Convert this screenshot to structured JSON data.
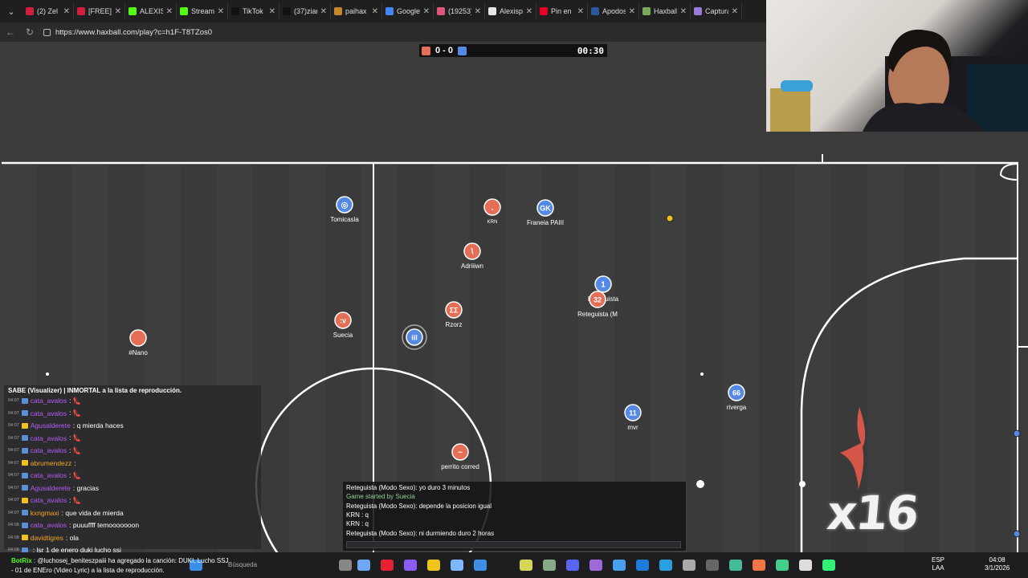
{
  "browser": {
    "tabs": [
      {
        "title": "(2) Zel",
        "color": "#d01f3c"
      },
      {
        "title": "[FREE] E",
        "color": "#d01f3c"
      },
      {
        "title": "ALEXIS",
        "color": "#53fc18"
      },
      {
        "title": "Stream",
        "color": "#53fc18"
      },
      {
        "title": "TikTok",
        "color": "#111111"
      },
      {
        "title": "(37)zian",
        "color": "#111111"
      },
      {
        "title": "paihax",
        "color": "#c8862b"
      },
      {
        "title": "Google",
        "color": "#4285f4"
      },
      {
        "title": "(19253)",
        "color": "#e0567a"
      },
      {
        "title": "Alexisp",
        "color": "#e6e6e6"
      },
      {
        "title": "Pin en",
        "color": "#e60023"
      },
      {
        "title": "Apodos",
        "color": "#2b579a"
      },
      {
        "title": "Haxball",
        "color": "#7aa75a"
      },
      {
        "title": "Captura",
        "color": "#9b7bd8"
      }
    ],
    "url": "https://www.haxball.com/play?c=h1F-T8TZos0"
  },
  "scoreboard": {
    "score": "0 - 0",
    "time": "00:30",
    "red_color": "#e56e56",
    "blue_color": "#5689e5"
  },
  "players": [
    {
      "label": "◎",
      "name": "Tomicasla",
      "team": "blue"
    },
    {
      "label": ".",
      "name": "KRN",
      "team": "red"
    },
    {
      "label": "GK",
      "name": "Franeia PAIII",
      "team": "blue"
    },
    {
      "label": "\\",
      "name": "Adriiiwn",
      "team": "red"
    },
    {
      "label": "1",
      "name": "Retequista",
      "team": "blue"
    },
    {
      "label": "32",
      "name": "Reteguista (M",
      "team": "red"
    },
    {
      "label": ":v",
      "name": "Suecia",
      "team": "red"
    },
    {
      "label": "ΣΣ",
      "name": "Rzorz",
      "team": "red"
    },
    {
      "label": "iiI",
      "name": "",
      "team": "blue"
    },
    {
      "label": "",
      "name": "#Nano",
      "team": "red"
    },
    {
      "label": "66",
      "name": "riverga",
      "team": "blue"
    },
    {
      "label": "11",
      "name": "mvr",
      "team": "blue"
    },
    {
      "label": "~",
      "name": "perrito corred",
      "team": "red"
    }
  ],
  "stream_chat": {
    "top_line": "SABE (Visualizer) | INMORTAL a la lista de reproducción.",
    "lines": [
      {
        "ts": "04:07",
        "user": "cata_avalos",
        "color": "#b65cf5",
        "msg": "👠"
      },
      {
        "ts": "04:07",
        "user": "cata_avalos",
        "color": "#b65cf5",
        "msg": "👠"
      },
      {
        "ts": "04:07",
        "user": "Agusalderete",
        "color": "#b65cf5",
        "msg": "q mierda haces"
      },
      {
        "ts": "04:07",
        "user": "cata_avalos",
        "color": "#b65cf5",
        "msg": "👠"
      },
      {
        "ts": "04:07",
        "user": "cata_avalos",
        "color": "#b65cf5",
        "msg": "👠"
      },
      {
        "ts": "04:07",
        "user": "abrumendezz",
        "color": "#f5a623",
        "msg": ""
      },
      {
        "ts": "04:07",
        "user": "cata_avalos",
        "color": "#b65cf5",
        "msg": "👠"
      },
      {
        "ts": "04:07",
        "user": "Agusalderete",
        "color": "#b65cf5",
        "msg": "gracias"
      },
      {
        "ts": "04:07",
        "user": "cata_avalos",
        "color": "#b65cf5",
        "msg": "👠"
      },
      {
        "ts": "04:07",
        "user": "kxngmaxi",
        "color": "#f5a623",
        "msg": "que vida de mierda"
      },
      {
        "ts": "04:08",
        "user": "cata_avalos",
        "color": "#b65cf5",
        "msg": "puuuffff temooooooon"
      },
      {
        "ts": "04:08",
        "user": "davidtigres",
        "color": "#f5a623",
        "msg": "ola"
      },
      {
        "ts": "04:08",
        "user": "",
        "color": "#e0245e",
        "msg": "lsr 1 de enero duki lucho ssj"
      }
    ]
  },
  "bottom_message": {
    "sender": "BotRix",
    "text": "@luchosej_beniteszpaiii ha agregado la canción: DUKI, Lucho SSJ",
    "text2": "- 01 de ENEro (Video Lyric) a la lista de reproducción."
  },
  "game_chat": [
    {
      "text": "Reteguista (Modo Sexo): yo duro 3 minutos",
      "color": "#ffffff"
    },
    {
      "text": "Game started by Suecia",
      "color": "#8fd18f"
    },
    {
      "text": "Reteguista (Modo Sexo): depende la posicion igual",
      "color": "#ffffff"
    },
    {
      "text": "KRN : q",
      "color": "#ffffff"
    },
    {
      "text": "KRN : q",
      "color": "#ffffff"
    },
    {
      "text": "Reteguista (Modo Sexo): ni durmiendo duro 2 horas",
      "color": "#ffffff"
    }
  ],
  "overlay_text": "x16",
  "taskbar": {
    "search_placeholder": "Búsqueda",
    "lang": "ESP",
    "lang2": "LAA",
    "time": "04:08",
    "date": "3/1/2026"
  }
}
